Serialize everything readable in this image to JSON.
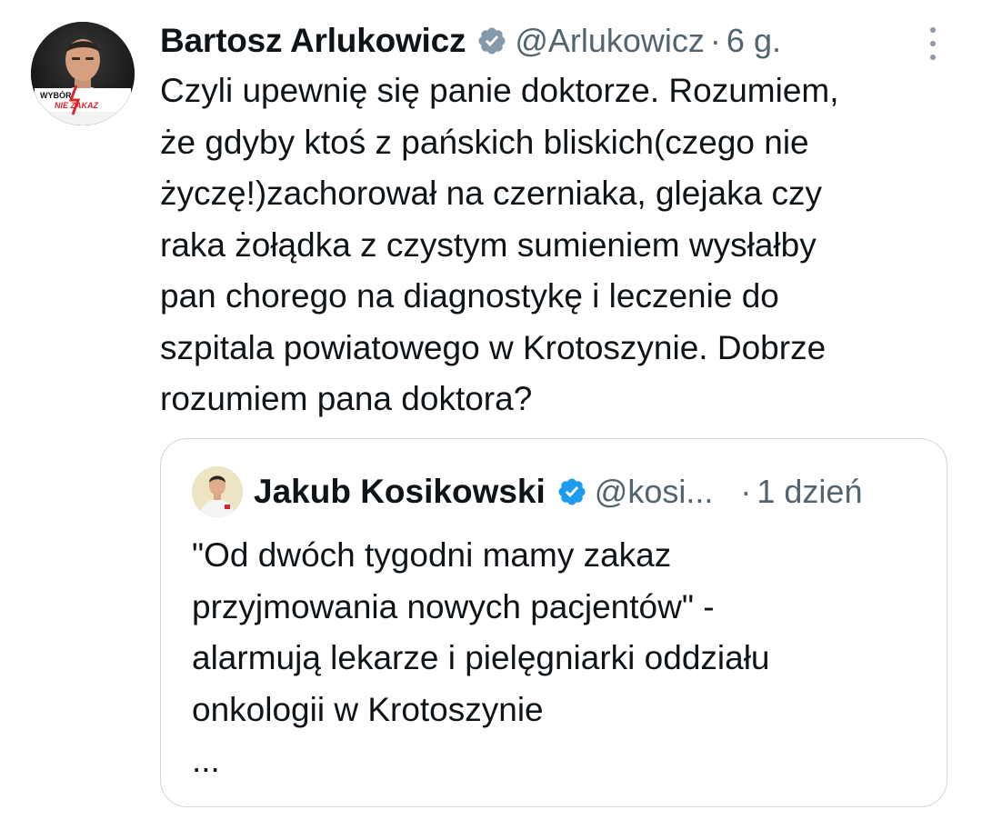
{
  "tweet": {
    "author_name": "Bartosz Arlukowicz",
    "author_handle": "@Arlukowicz",
    "separator": "·",
    "time": "6 g.",
    "avatar_caption_line1": "WYBÓR",
    "avatar_caption_line2": "NIE ZAKAZ",
    "verified_color": "#829aab",
    "text_lines": [
      "Czyli upewnię się panie doktorze. Rozumiem,",
      "że gdyby ktoś z pańskich bliskich(czego nie",
      "życzę!)zachorował na czerniaka, glejaka czy",
      "raka żołądka z czystym sumieniem wysłałby",
      "pan chorego na diagnostykę i leczenie do",
      "szpitala powiatowego w Krotoszynie. Dobrze",
      "rozumiem pana doktora?"
    ]
  },
  "quoted": {
    "author_name": "Jakub Kosikowski",
    "author_handle": "@kosi...",
    "separator": "·",
    "time": "1 dzień",
    "verified_color": "#1d9bf0",
    "text_lines": [
      "\"Od dwóch tygodni mamy zakaz",
      "przyjmowania nowych pacjentów\" -",
      "alarmują lekarze i pielęgniarki oddziału",
      "onkologii w Krotoszynie",
      "..."
    ]
  },
  "icons": {
    "more": "more-vertical-icon",
    "verified": "verified-badge-icon"
  }
}
